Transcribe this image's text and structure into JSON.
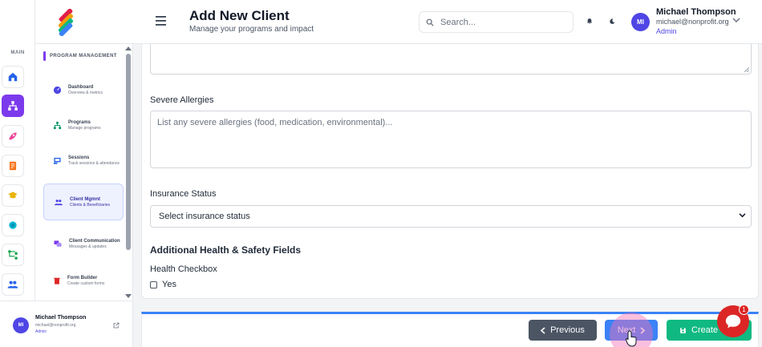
{
  "header": {
    "title": "Add New Client",
    "subtitle": "Manage your programs and impact",
    "search_placeholder": "Search...",
    "user": {
      "initials": "MI",
      "name": "Michael Thompson",
      "email": "michael@nonprofit.org",
      "role": "Admin"
    }
  },
  "rail": {
    "section_label": "MAIN",
    "icons": [
      "home-icon",
      "programs-icon",
      "rocket-icon",
      "document-icon",
      "graduation-icon",
      "globe-icon",
      "flow-icon",
      "users-icon"
    ]
  },
  "menu": {
    "section_title": "PROGRAM MANAGEMENT",
    "items": [
      {
        "title": "Dashboard",
        "subtitle": "Overview & metrics",
        "icon": "dashboard-icon"
      },
      {
        "title": "Programs",
        "subtitle": "Manage programs",
        "icon": "sitemap-icon"
      },
      {
        "title": "Sessions",
        "subtitle": "Track sessions & attendance",
        "icon": "session-icon"
      },
      {
        "title": "Client Mgmnt",
        "subtitle": "Clients & Beneficiaries",
        "icon": "users-icon",
        "active": true
      },
      {
        "title": "Client Communication",
        "subtitle": "Messages & updates",
        "icon": "chat-icon"
      },
      {
        "title": "Form Builder",
        "subtitle": "Create custom forms",
        "icon": "trash-icon"
      }
    ]
  },
  "sidebar_user": {
    "initials": "MI",
    "name": "Michael Thompson",
    "email": "michael@nonprofit.org",
    "role": "Admin"
  },
  "form": {
    "allergies_label": "Severe Allergies",
    "allergies_placeholder": "List any severe allergies (food, medication, environmental)...",
    "insurance_label": "Insurance Status",
    "insurance_value": "Select insurance status",
    "section_title": "Additional Health & Safety Fields",
    "health_checkbox_label": "Health Checkbox",
    "health_checkbox_option": "Yes"
  },
  "footer": {
    "previous_label": "Previous",
    "next_label": "Next",
    "create_label": "Create C"
  },
  "chat": {
    "badge": "1"
  },
  "colors": {
    "accent": "#7c3aed",
    "primary": "#3b82f6",
    "success": "#10b981",
    "secondary": "#4b5563",
    "chat": "#dc2626"
  }
}
